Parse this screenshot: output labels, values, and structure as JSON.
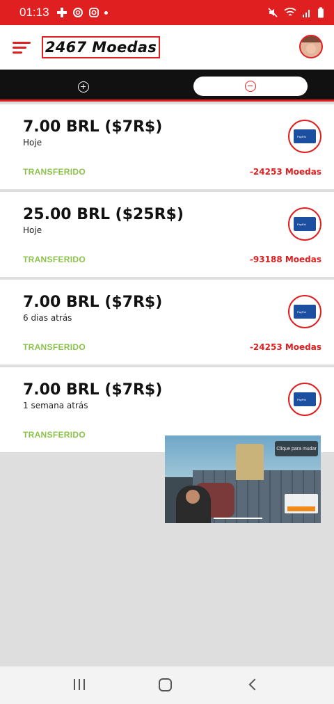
{
  "status_bar": {
    "time": "01:13",
    "left_icons": [
      "gamepad-icon",
      "circle-icon",
      "instagram-icon",
      "dot-icon"
    ],
    "right_icons": [
      "mute-icon",
      "wifi-icon",
      "signal-icon",
      "battery-icon"
    ]
  },
  "header": {
    "coins": "2467 Moedas",
    "menu_icon": "hamburger-menu-icon",
    "avatar_icon": "user-avatar"
  },
  "tabs": [
    {
      "icon": "plus-circle-icon",
      "selected": false
    },
    {
      "icon": "minus-circle-icon",
      "selected": true
    }
  ],
  "transactions": [
    {
      "amount": "7.00 BRL ($7R$)",
      "date": "Hoje",
      "status": "TRANSFERIDO",
      "coins": "-24253 Moedas",
      "method_icon": "paypal-card-icon",
      "method_label": "PayPal"
    },
    {
      "amount": "25.00 BRL ($25R$)",
      "date": "Hoje",
      "status": "TRANSFERIDO",
      "coins": "-93188 Moedas",
      "method_icon": "paypal-card-icon",
      "method_label": "PayPal"
    },
    {
      "amount": "7.00 BRL ($7R$)",
      "date": "6 dias atrás",
      "status": "TRANSFERIDO",
      "coins": "-24253 Moedas",
      "method_icon": "paypal-card-icon",
      "method_label": "PayPal"
    },
    {
      "amount": "7.00 BRL ($7R$)",
      "date": "1 semana atrás",
      "status": "TRANSFERIDO",
      "coins": "",
      "method_icon": "paypal-card-icon",
      "method_label": "PayPal"
    }
  ],
  "video_overlay": {
    "hint": "Clique para mudar"
  },
  "nav_bar": {
    "icons": [
      "recent-apps-icon",
      "home-icon",
      "back-icon"
    ]
  },
  "colors": {
    "brand_red": "#e02020",
    "status_green": "#8bc34a",
    "tab_bar_bg": "#111111",
    "paypal_blue": "#1d4fa0"
  }
}
